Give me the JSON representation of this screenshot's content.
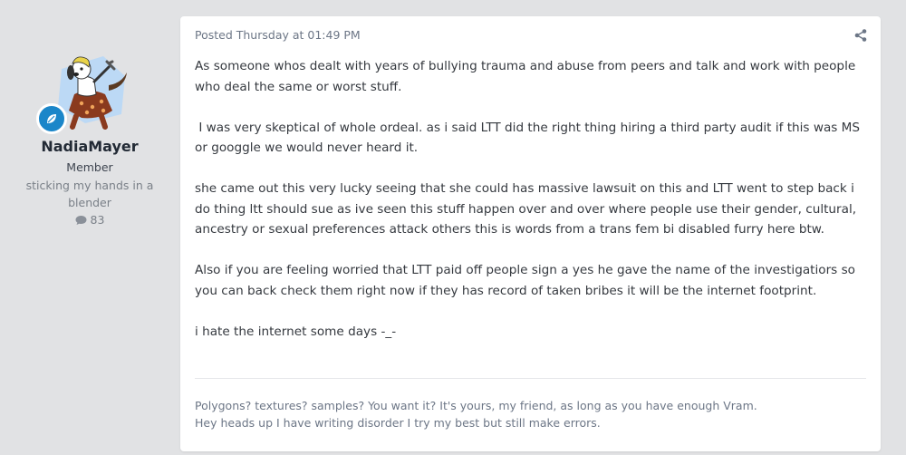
{
  "author": {
    "name": "NadiaMayer",
    "title": "Member",
    "tagline": "sticking my hands in a blender",
    "post_count": "83",
    "avatar_icon": "furry-character-avatar",
    "badge_icon": "leaf-badge-icon",
    "badge_color": "#1b86c9"
  },
  "post": {
    "meta": "Posted Thursday at 01:49 PM",
    "share_icon": "share-icon",
    "paragraphs": [
      "As someone whos dealt with years of bullying trauma and abuse from peers and talk and work with people who deal the same or worst stuff.",
      " I was very skeptical of whole ordeal. as i said LTT did the right thing hiring a third party audit if this was MS or googgle we would never heard it.",
      "she came out this very lucky seeing that she could has massive lawsuit on this and LTT went to step back i do thing ltt should sue as ive seen this stuff happen over and over where people use their gender, cultural, ancestry or sexual preferences attack others this is words from a trans fem bi disabled furry here btw.",
      "Also if you are feeling worried that LTT paid off people sign a yes he gave the name of the investigatiors so you can back check them right now if they has record of taken bribes it will be the internet footprint.",
      "i hate the internet some days -_-"
    ],
    "signature": [
      "Polygons? textures?  samples? You want it? It's yours, my friend, as long as you have enough Vram.",
      "Hey heads up I  have writing disorder I try my best but still make errors."
    ]
  }
}
